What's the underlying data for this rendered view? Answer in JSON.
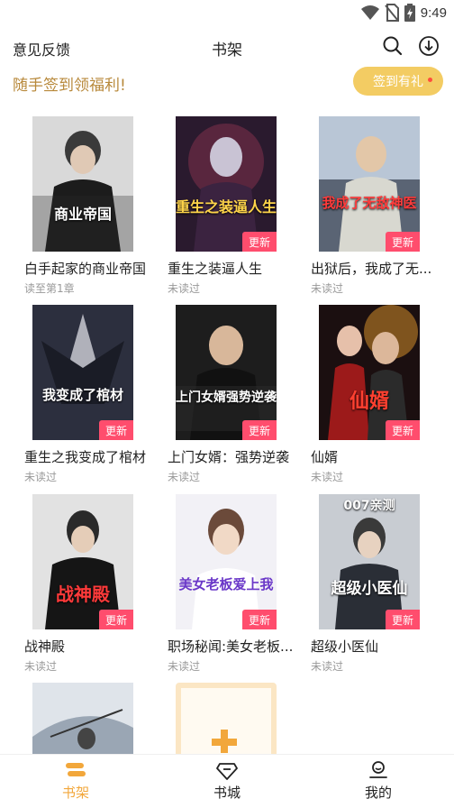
{
  "status": {
    "time": "9:49"
  },
  "header": {
    "feedback": "意见反馈",
    "title": "书架"
  },
  "signin": {
    "promo": "随手签到领福利!",
    "button": "签到有礼"
  },
  "badge_label": "更新",
  "books": [
    {
      "title": "白手起家的商业帝国",
      "progress": "读至第1章",
      "cover_text": "商业帝国",
      "updated": false
    },
    {
      "title": "重生之装逼人生",
      "progress": "未读过",
      "cover_text": "重生之装逼人生",
      "updated": true
    },
    {
      "title": "出狱后，我成了无...",
      "progress": "未读过",
      "cover_text": "我成了无敌神医",
      "updated": true
    },
    {
      "title": "重生之我变成了棺材",
      "progress": "未读过",
      "cover_text": "我变成了棺材",
      "updated": true
    },
    {
      "title": "上门女婿：强势逆袭",
      "progress": "未读过",
      "cover_text": "上门女婿强势逆袭",
      "updated": true
    },
    {
      "title": "仙婿",
      "progress": "未读过",
      "cover_text": "仙婿",
      "updated": true
    },
    {
      "title": "战神殿",
      "progress": "未读过",
      "cover_text": "战神殿",
      "updated": true
    },
    {
      "title": "职场秘闻:美女老板...",
      "progress": "未读过",
      "cover_text": "美女老板爱上我",
      "updated": true
    },
    {
      "title": "超级小医仙",
      "progress": "未读过",
      "cover_text": "超级小医仙",
      "cover_top": "007亲测",
      "updated": true
    }
  ],
  "nav": {
    "shelf": "书架",
    "store": "书城",
    "mine": "我的"
  },
  "colors": {
    "accent": "#f2a73b",
    "signin_bg": "#f3cc63",
    "promo_text": "#b8893b",
    "badge": "#ff4d6d"
  }
}
